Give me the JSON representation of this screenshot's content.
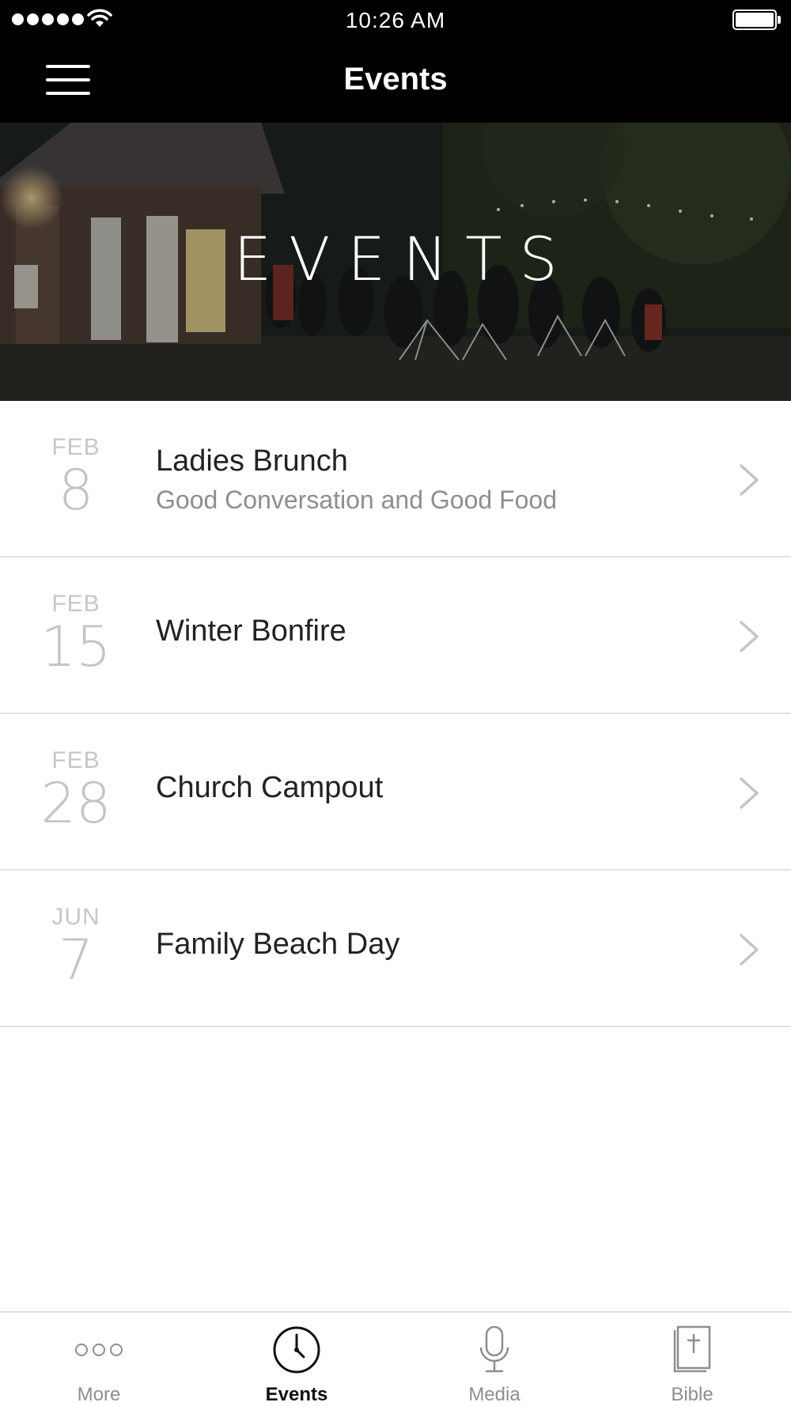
{
  "status_bar": {
    "time": "10:26 AM"
  },
  "nav": {
    "title": "Events"
  },
  "hero": {
    "title": "EVENTS"
  },
  "events": [
    {
      "month": "FEB",
      "day": "8",
      "title": "Ladies Brunch",
      "subtitle": "Good Conversation and Good Food"
    },
    {
      "month": "FEB",
      "day": "15",
      "title": "Winter Bonfire"
    },
    {
      "month": "FEB",
      "day": "28",
      "title": "Church Campout"
    },
    {
      "month": "JUN",
      "day": "7",
      "title": "Family Beach Day"
    }
  ],
  "tabs": [
    {
      "label": "More",
      "icon": "more-icon"
    },
    {
      "label": "Events",
      "icon": "clock-icon",
      "active": true
    },
    {
      "label": "Media",
      "icon": "microphone-icon"
    },
    {
      "label": "Bible",
      "icon": "bible-icon"
    }
  ],
  "colors": {
    "header": "#000000",
    "separator": "#e3e3e3",
    "date_text": "#c7c7c7",
    "subtitle_text": "#8e8e8e"
  }
}
